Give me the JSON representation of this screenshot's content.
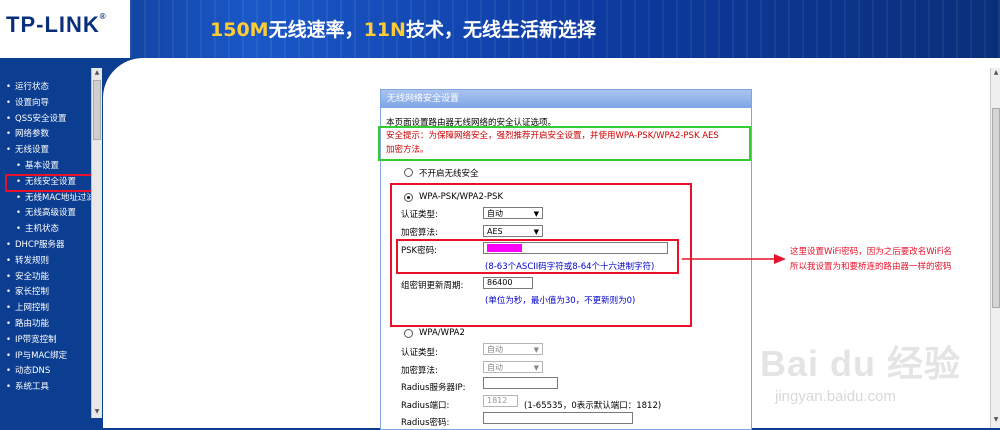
{
  "banner": {
    "logo": "TP-LINK",
    "logo_mark": "®",
    "slogan_part1": "150M",
    "slogan_part2": "无线速率，",
    "slogan_part3": "11N",
    "slogan_part4": "技术，无线生活新选择"
  },
  "nav": {
    "items": [
      {
        "label": "运行状态",
        "sub": false
      },
      {
        "label": "设置向导",
        "sub": false
      },
      {
        "label": "QSS安全设置",
        "sub": false
      },
      {
        "label": "网络参数",
        "sub": false
      },
      {
        "label": "无线设置",
        "sub": false
      },
      {
        "label": "基本设置",
        "sub": true
      },
      {
        "label": "无线安全设置",
        "sub": true,
        "active": true
      },
      {
        "label": "无线MAC地址过滤",
        "sub": true
      },
      {
        "label": "无线高级设置",
        "sub": true
      },
      {
        "label": "主机状态",
        "sub": true
      },
      {
        "label": "DHCP服务器",
        "sub": false
      },
      {
        "label": "转发规则",
        "sub": false
      },
      {
        "label": "安全功能",
        "sub": false
      },
      {
        "label": "家长控制",
        "sub": false
      },
      {
        "label": "上网控制",
        "sub": false
      },
      {
        "label": "路由功能",
        "sub": false
      },
      {
        "label": "IP带宽控制",
        "sub": false
      },
      {
        "label": "IP与MAC绑定",
        "sub": false
      },
      {
        "label": "动态DNS",
        "sub": false
      },
      {
        "label": "系统工具",
        "sub": false
      }
    ]
  },
  "panel": {
    "title": "无线网络安全设置",
    "intro": "本页面设置路由器无线网络的安全认证选项。",
    "tip_line1": "安全提示：为保障网络安全，强烈推荐开启安全设置，并使用WPA-PSK/WPA2-PSK AES",
    "tip_line2": "加密方法。",
    "opt_disable": "不开启无线安全",
    "opt_wpa_psk": "WPA-PSK/WPA2-PSK",
    "auth_type_label": "认证类型:",
    "auth_type_value": "自动",
    "enc_label": "加密算法:",
    "enc_value": "AES",
    "psk_label": "PSK密码:",
    "psk_hint": "(8-63个ASCII码字符或8-64个十六进制字符)",
    "renew_label": "组密钥更新周期:",
    "renew_value": "86400",
    "renew_hint": "(单位为秒，最小值为30，不更新则为0)",
    "opt_wpa": "WPA/WPA2",
    "auth_type2_label": "认证类型:",
    "auth_type2_value": "自动",
    "enc2_label": "加密算法:",
    "enc2_value": "自动",
    "radius_ip_label": "Radius服务器IP:",
    "radius_port_label": "Radius端口:",
    "radius_port_value": "1812",
    "radius_port_hint": "(1-65535，0表示默认端口：1812)",
    "radius_pwd_label": "Radius密码:"
  },
  "annotation": {
    "line1": "这里设置WiFi密码，因为之后要改名WiFi名",
    "line2": "所以我设置为和要桥连的路由器一样的密码"
  },
  "watermark": {
    "main": "Bai du 经验",
    "sub": "jingyan.baidu.com"
  },
  "colors": {
    "nav_bg": "#0b3d91",
    "panel_header": "#7ea5e6",
    "highlight_red": "#e8102a",
    "highlight_green": "#33cc33",
    "redaction": "#ff00ff"
  }
}
